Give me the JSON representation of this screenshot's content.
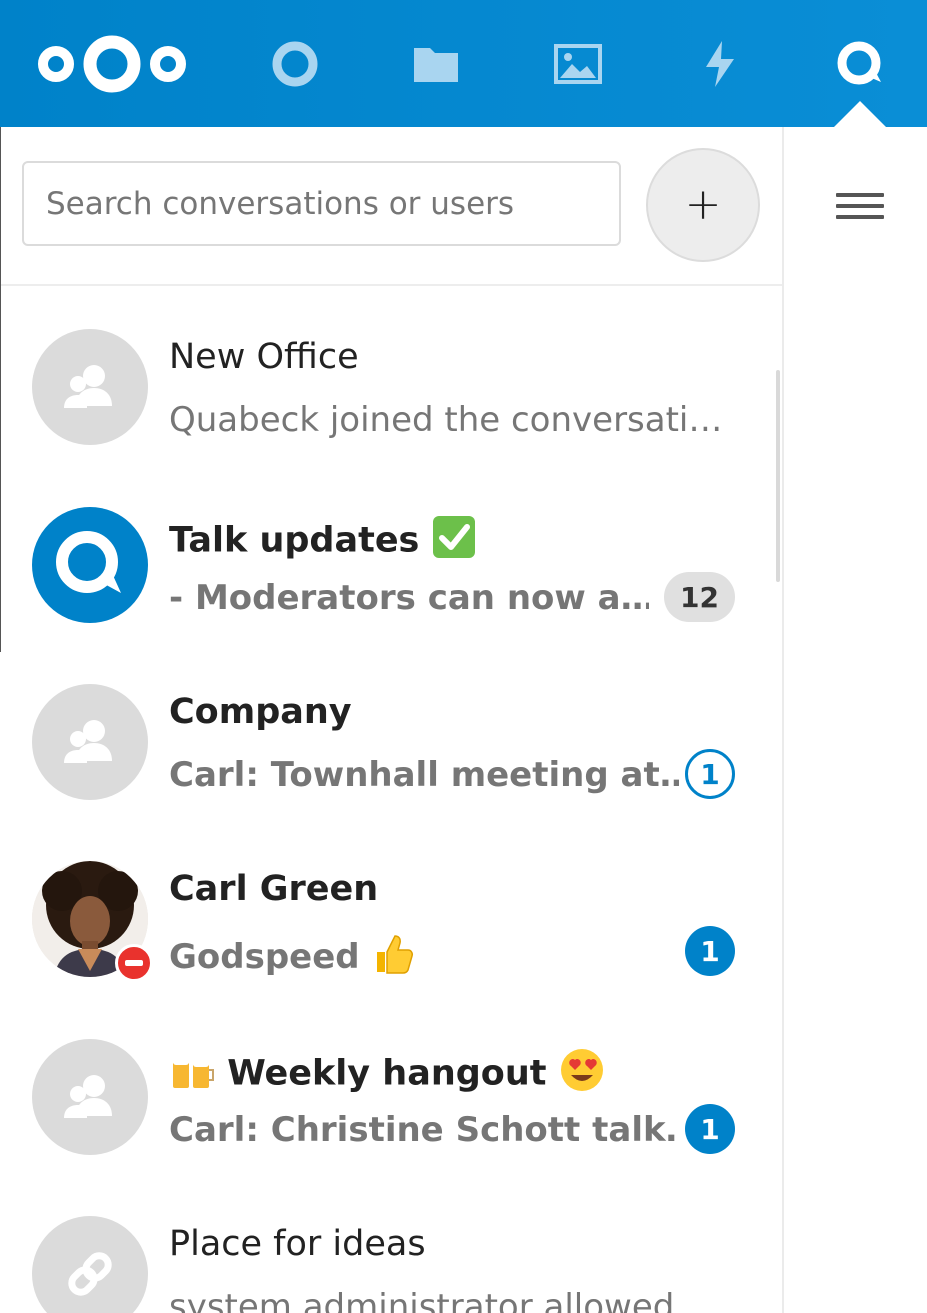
{
  "header": {
    "nav": [
      {
        "name": "nextcloud-logo"
      },
      {
        "name": "dashboard-icon"
      },
      {
        "name": "files-icon"
      },
      {
        "name": "photos-icon"
      },
      {
        "name": "activity-icon"
      },
      {
        "name": "talk-icon",
        "active": true
      }
    ],
    "accent": "#0082c9"
  },
  "search": {
    "placeholder": "Search conversations or users"
  },
  "add_button": {
    "label": "+"
  },
  "conversations": [
    {
      "name": "New Office",
      "last_message": "Quabeck joined the conversati…",
      "unread": null,
      "avatar": "group-icon",
      "bold": false
    },
    {
      "name": "Talk updates",
      "name_emoji": "✅",
      "last_message": "- Moderators can now a…",
      "unread": "12",
      "badge_style": "grey",
      "avatar": "talk-logo",
      "bold": true
    },
    {
      "name": "Company",
      "last_message": "Carl: Townhall meeting at…",
      "unread": "1",
      "badge_style": "outline",
      "avatar": "group-icon",
      "bold": true
    },
    {
      "name": "Carl Green",
      "last_message": "Godspeed",
      "message_emoji": "👍",
      "unread": "1",
      "badge_style": "fill",
      "avatar": "user-photo",
      "status": "do-not-disturb",
      "bold": true
    },
    {
      "name": "Weekly hangout",
      "name_prefix_emoji": "🍻",
      "name_emoji": "😍",
      "last_message": "Carl: Christine Schott talk…",
      "unread": "1",
      "badge_style": "fill",
      "avatar": "group-icon",
      "bold": true
    },
    {
      "name": "Place for ideas",
      "last_message": "system administrator allowed…",
      "unread": null,
      "avatar": "link-icon",
      "bold": false
    }
  ]
}
